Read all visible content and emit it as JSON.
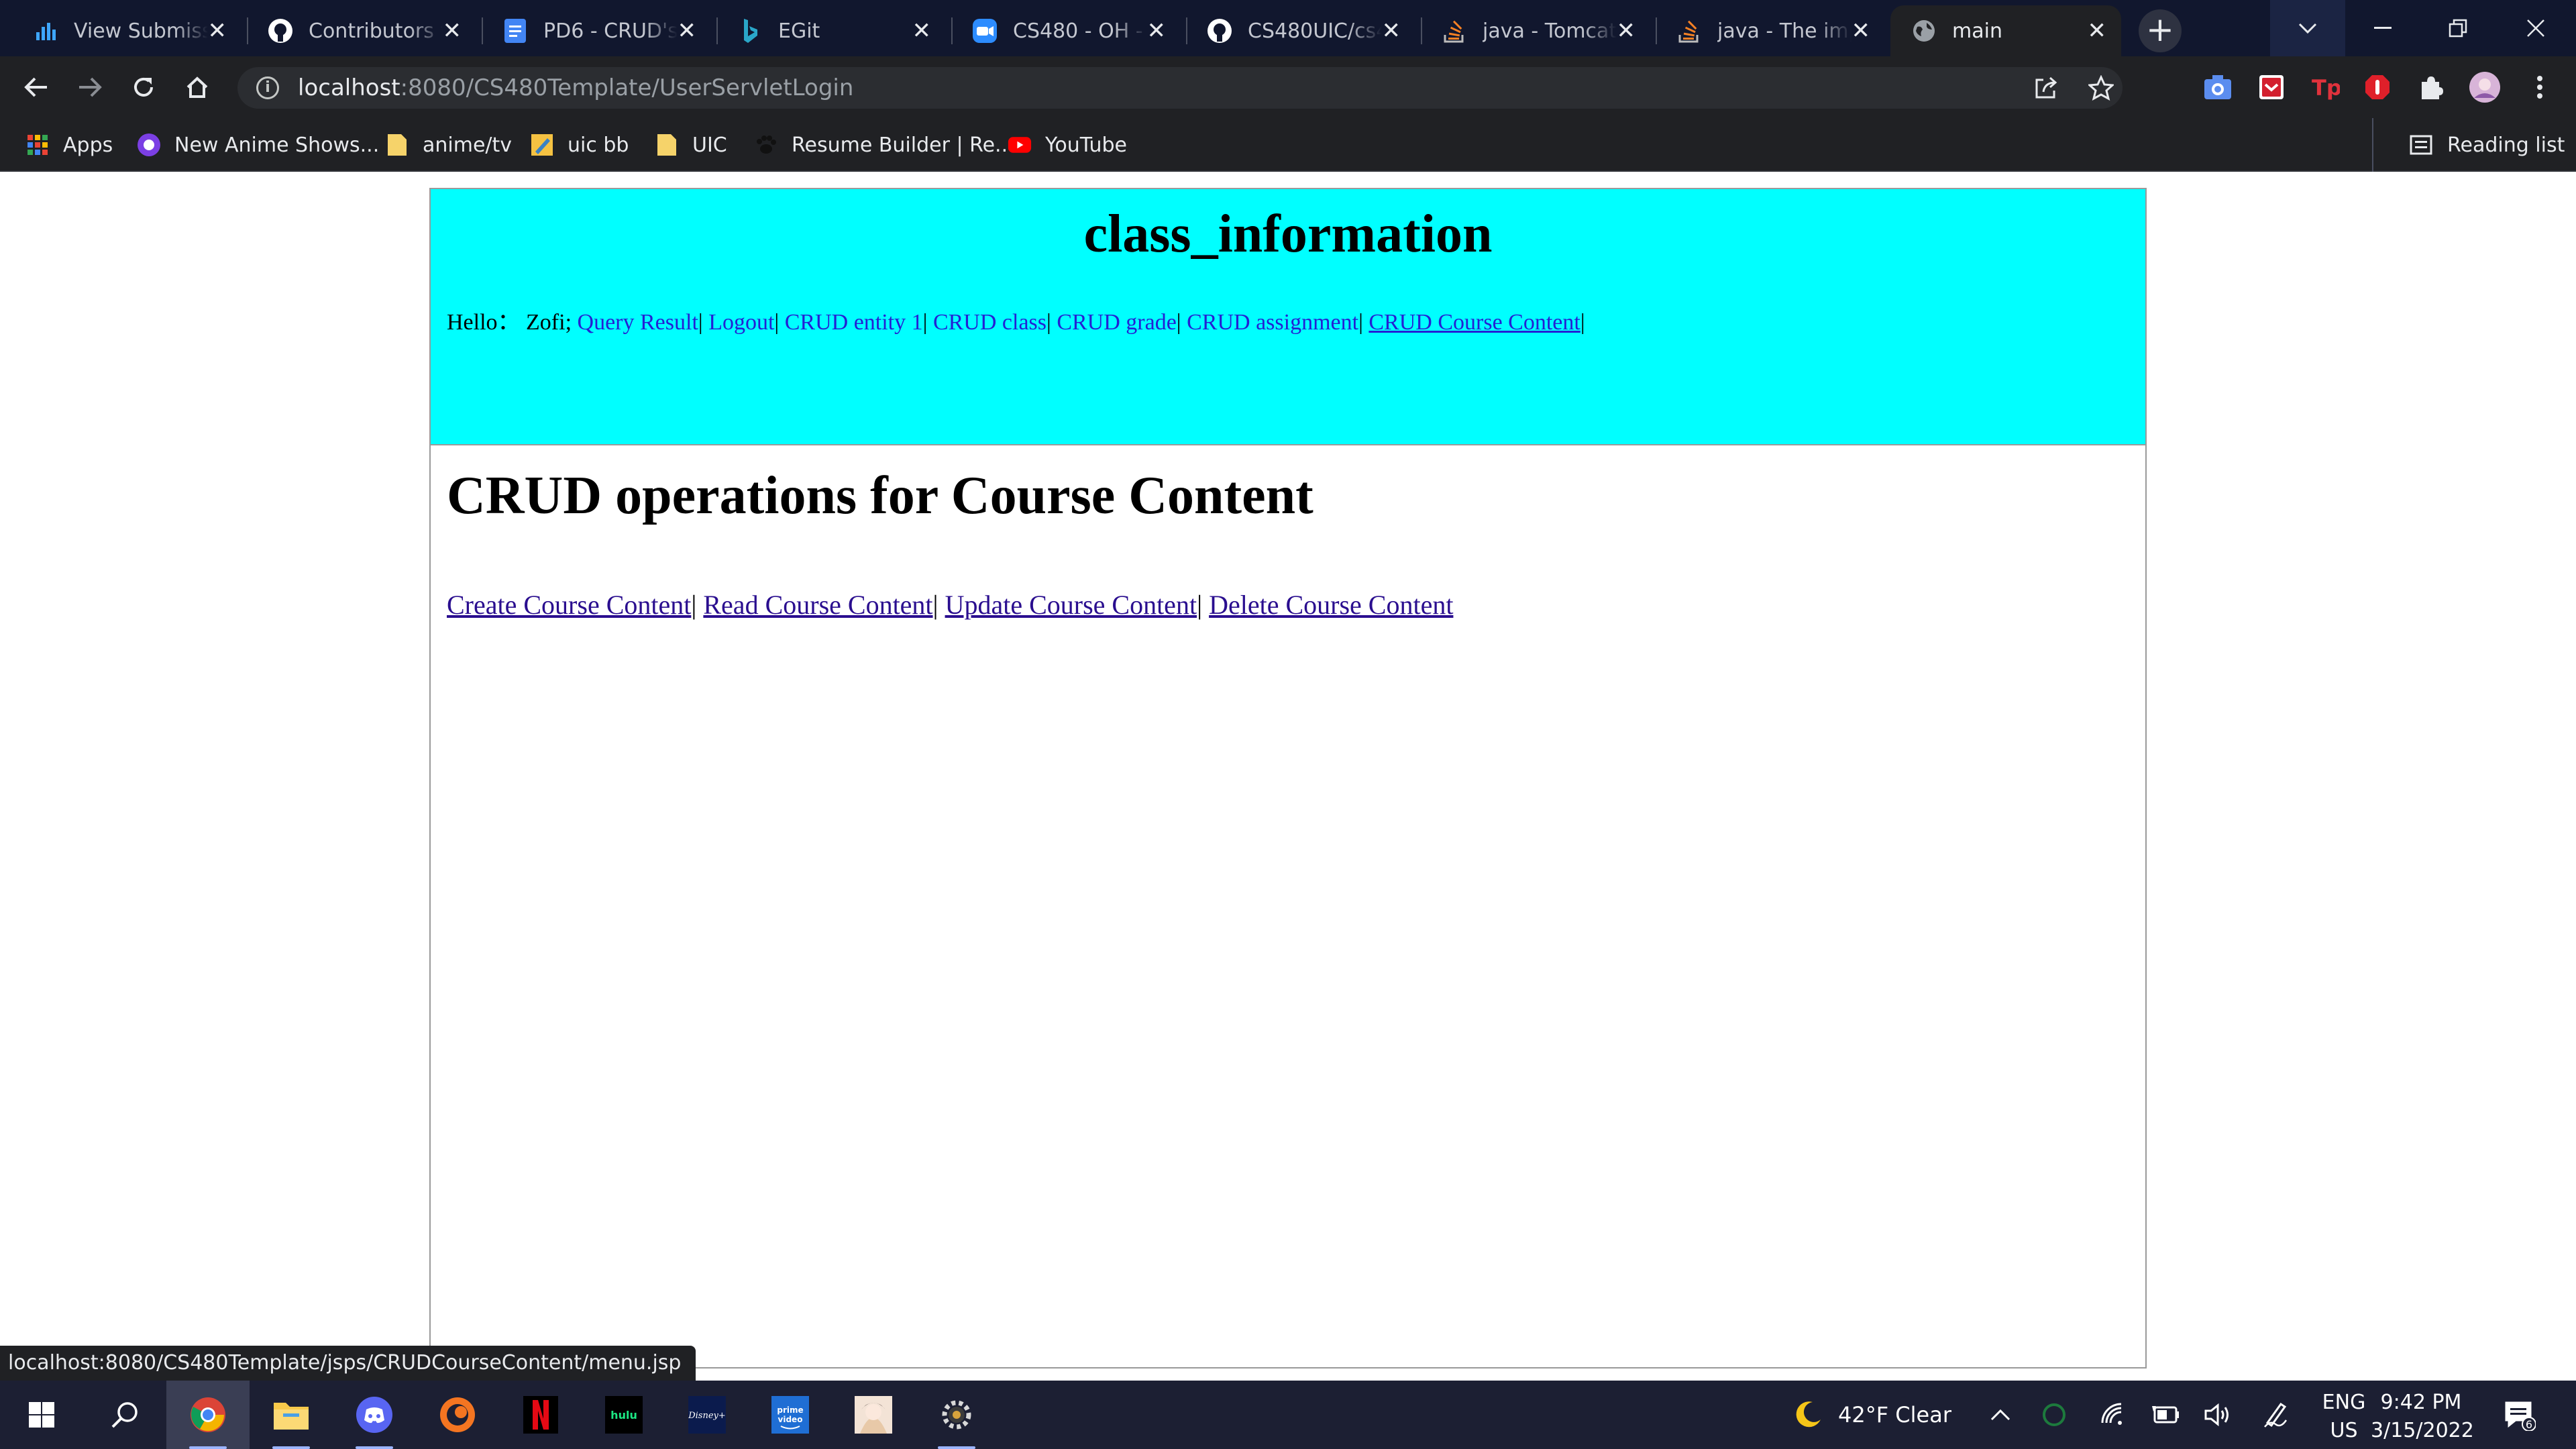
{
  "browser": {
    "tabs": [
      {
        "title": "View Submissi",
        "icon": "bar-chart-icon",
        "color": "#3ea6ff"
      },
      {
        "title": "Contributors t",
        "icon": "github-icon",
        "color": "#ffffff"
      },
      {
        "title": "PD6 - CRUD's",
        "icon": "google-docs-icon",
        "color": "#4285f4"
      },
      {
        "title": "EGit",
        "icon": "bing-icon",
        "color": "#2aa7c9"
      },
      {
        "title": "CS480 - OH -",
        "icon": "zoom-icon",
        "color": "#2d8cff"
      },
      {
        "title": "CS480UIC/cs4",
        "icon": "github-icon",
        "color": "#ffffff"
      },
      {
        "title": "java - Tomcat",
        "icon": "stackoverflow-icon",
        "color": "#f48024"
      },
      {
        "title": "java - The imp",
        "icon": "stackoverflow-icon",
        "color": "#f48024"
      },
      {
        "title": "main",
        "icon": "globe-icon",
        "color": "#9aa0a6",
        "active": true
      }
    ],
    "new_tab_symbol": "+",
    "url_host": "localhost",
    "url_rest": ":8080/CS480Template/UserServletLogin",
    "bookmarks": [
      {
        "label": "Apps",
        "icon": "apps-grid-icon"
      },
      {
        "label": "New Anime Shows...",
        "icon": "anime-icon"
      },
      {
        "label": "anime/tv",
        "icon": "folder-icon"
      },
      {
        "label": "uic bb",
        "icon": "pencil-icon"
      },
      {
        "label": "UIC",
        "icon": "folder-icon"
      },
      {
        "label": "Resume Builder | Re...",
        "icon": "paw-icon"
      },
      {
        "label": "YouTube",
        "icon": "youtube-icon"
      }
    ],
    "reading_list": "Reading list",
    "status_url": "localhost:8080/CS480Template/jsps/CRUDCourseContent/menu.jsp"
  },
  "page": {
    "header_title": "class_information",
    "greeting": "Hello： Zofi;",
    "nav_links": [
      "Query Result",
      "Logout",
      "CRUD entity 1",
      "CRUD class",
      "CRUD grade",
      "CRUD assignment",
      "CRUD Course Content"
    ],
    "nav_separator": "|",
    "heading": "CRUD operations for Course Content",
    "crud_links": [
      "Create Course Content",
      "Read Course Content",
      "Update Course Content",
      "Delete Course Content"
    ]
  },
  "taskbar": {
    "weather": "42°F  Clear",
    "lang_line1": "ENG",
    "lang_line2": "US",
    "time": "9:42 PM",
    "date": "3/15/2022",
    "notifications": "6"
  }
}
